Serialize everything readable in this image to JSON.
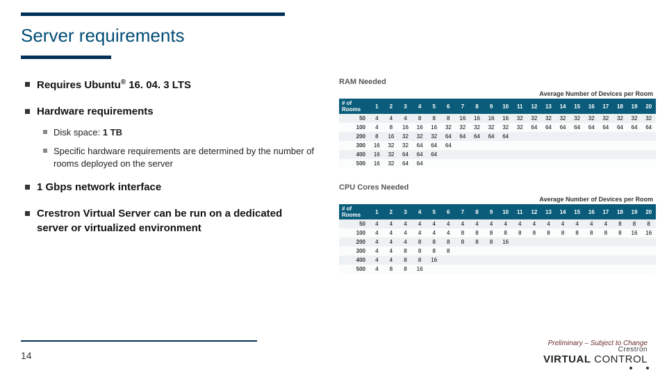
{
  "title": "Server requirements",
  "bullets": {
    "b1_pre": "Requires Ubuntu",
    "b1_sup": "®",
    "b1_post": " 16. 04. 3 LTS",
    "b2": "Hardware requirements",
    "b2a_label": "Disk space: ",
    "b2a_val": "1 TB",
    "b2b": "Specific hardware requirements are determined by the number of rooms deployed on the server",
    "b3": "1 Gbps network interface",
    "b4": "Crestron Virtual Server can be run on a dedicated server or virtualized environment"
  },
  "tables_common": {
    "subtitle": "Average Number of Devices per Room",
    "rooms_header": "# of Rooms",
    "columns": [
      "1",
      "2",
      "3",
      "4",
      "5",
      "6",
      "7",
      "8",
      "9",
      "10",
      "11",
      "12",
      "13",
      "14",
      "15",
      "16",
      "17",
      "18",
      "19",
      "20"
    ],
    "row_headers": [
      "50",
      "100",
      "200",
      "300",
      "400",
      "500"
    ]
  },
  "ram": {
    "title": "RAM Needed"
  },
  "cpu": {
    "title": "CPU Cores Needed"
  },
  "chart_data": [
    {
      "type": "table",
      "title": "RAM Needed",
      "xlabel": "Average Number of Devices per Room",
      "ylabel": "# of Rooms",
      "columns": [
        1,
        2,
        3,
        4,
        5,
        6,
        7,
        8,
        9,
        10,
        11,
        12,
        13,
        14,
        15,
        16,
        17,
        18,
        19,
        20
      ],
      "rows": [
        50,
        100,
        200,
        300,
        400,
        500
      ],
      "values": [
        [
          4,
          4,
          4,
          8,
          8,
          8,
          16,
          16,
          16,
          16,
          32,
          32,
          32,
          32,
          32,
          32,
          32,
          32,
          32,
          32
        ],
        [
          4,
          8,
          16,
          16,
          16,
          32,
          32,
          32,
          32,
          32,
          32,
          64,
          64,
          64,
          64,
          64,
          64,
          64,
          64,
          64
        ],
        [
          8,
          16,
          32,
          32,
          32,
          64,
          64,
          64,
          64,
          64,
          null,
          null,
          null,
          null,
          null,
          null,
          null,
          null,
          null,
          null
        ],
        [
          16,
          32,
          32,
          64,
          64,
          64,
          null,
          null,
          null,
          null,
          null,
          null,
          null,
          null,
          null,
          null,
          null,
          null,
          null,
          null
        ],
        [
          16,
          32,
          64,
          64,
          64,
          null,
          null,
          null,
          null,
          null,
          null,
          null,
          null,
          null,
          null,
          null,
          null,
          null,
          null,
          null
        ],
        [
          16,
          32,
          64,
          64,
          null,
          null,
          null,
          null,
          null,
          null,
          null,
          null,
          null,
          null,
          null,
          null,
          null,
          null,
          null,
          null
        ]
      ]
    },
    {
      "type": "table",
      "title": "CPU Cores Needed",
      "xlabel": "Average Number of Devices per Room",
      "ylabel": "# of Rooms",
      "columns": [
        1,
        2,
        3,
        4,
        5,
        6,
        7,
        8,
        9,
        10,
        11,
        12,
        13,
        14,
        15,
        16,
        17,
        18,
        19,
        20
      ],
      "rows": [
        50,
        100,
        200,
        300,
        400,
        500
      ],
      "values": [
        [
          4,
          4,
          4,
          4,
          4,
          4,
          4,
          4,
          4,
          4,
          4,
          4,
          4,
          4,
          4,
          4,
          4,
          8,
          8,
          8
        ],
        [
          4,
          4,
          4,
          4,
          4,
          4,
          8,
          8,
          8,
          8,
          8,
          8,
          8,
          8,
          8,
          8,
          8,
          8,
          16,
          16
        ],
        [
          4,
          4,
          4,
          8,
          8,
          8,
          8,
          8,
          8,
          16,
          null,
          null,
          null,
          null,
          null,
          null,
          null,
          null,
          null,
          null
        ],
        [
          4,
          4,
          8,
          8,
          8,
          8,
          null,
          null,
          null,
          null,
          null,
          null,
          null,
          null,
          null,
          null,
          null,
          null,
          null,
          null
        ],
        [
          4,
          4,
          8,
          8,
          16,
          null,
          null,
          null,
          null,
          null,
          null,
          null,
          null,
          null,
          null,
          null,
          null,
          null,
          null,
          null
        ],
        [
          4,
          8,
          8,
          16,
          null,
          null,
          null,
          null,
          null,
          null,
          null,
          null,
          null,
          null,
          null,
          null,
          null,
          null,
          null,
          null
        ]
      ]
    }
  ],
  "footer": {
    "page": "14",
    "prelim": "Preliminary – Subject to Change",
    "logo1": "Crestron",
    "logo2a": "VIRTUAL",
    "logo2b": " CONTROL"
  }
}
